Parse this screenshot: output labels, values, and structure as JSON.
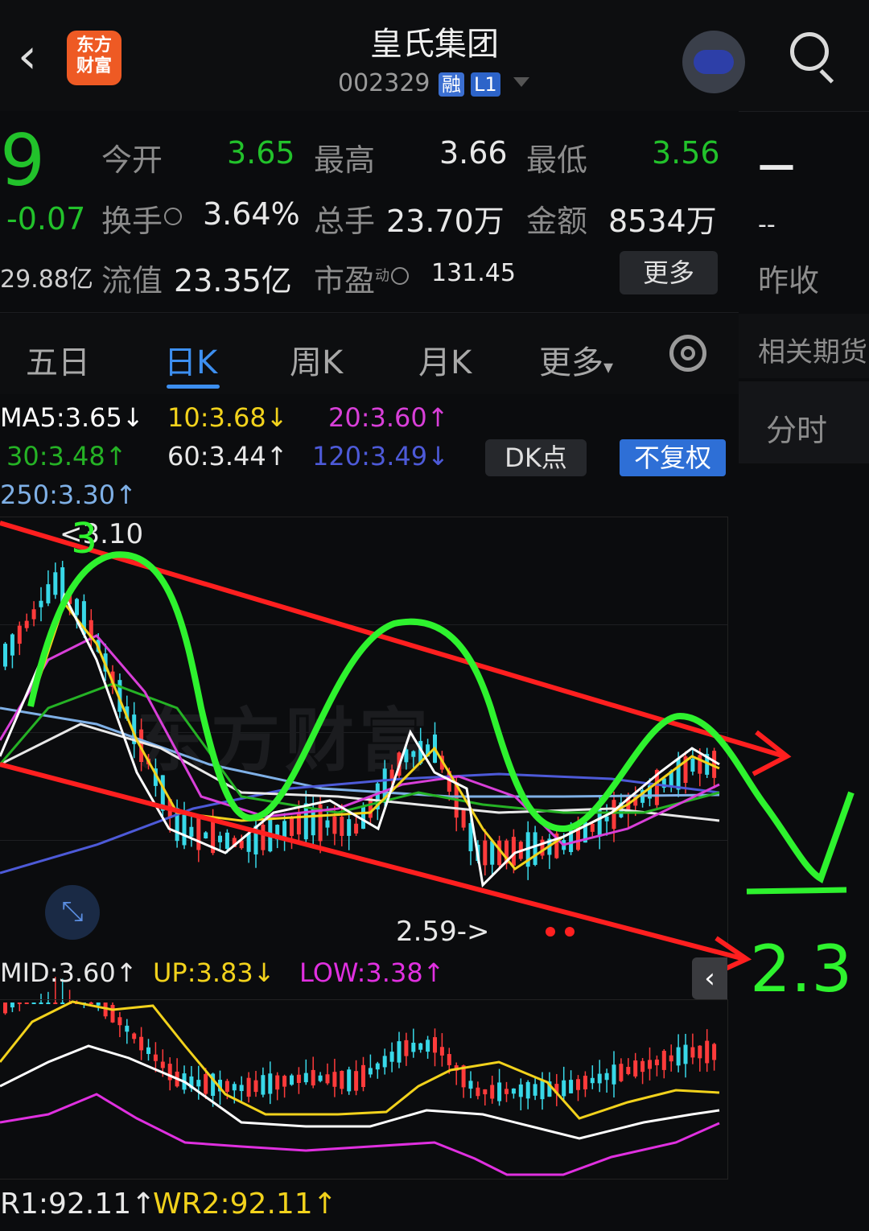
{
  "header": {
    "back_icon": "chevron-left-icon",
    "logo_text_line1": "东方",
    "logo_text_line2": "财富",
    "stock_name": "皇氏集团",
    "stock_code": "002329",
    "tag_margin": "融",
    "tag_level": "L1"
  },
  "quote": {
    "price_partial": "9",
    "change": "-0.07",
    "market_cap_partial": "29.88亿",
    "open_label": "今开",
    "open_value": "3.65",
    "high_label": "最高",
    "high_value": "3.66",
    "low_label": "最低",
    "low_value": "3.56",
    "turnover_label": "换手",
    "turnover_value": "3.64%",
    "volume_label": "总手",
    "volume_value": "23.70万",
    "amount_label": "金额",
    "amount_value": "8534万",
    "float_label": "流值",
    "float_value": "23.35亿",
    "pe_label": "市盈",
    "pe_sup": "动",
    "pe_value": "131.45",
    "more_button": "更多"
  },
  "right_panel": {
    "dash1": "—",
    "dash2": "--",
    "prev_close_label": "昨收",
    "futures_label": "相关期货",
    "intraday_label": "分时"
  },
  "tabs": {
    "items": [
      "五日",
      "日K",
      "周K",
      "月K",
      "更多"
    ],
    "active": "日K",
    "more_caret": "▾"
  },
  "ma_legend": {
    "ma5": "MA5:3.65↓",
    "ma10": "10:3.68↓",
    "ma20": "20:3.60↑",
    "ma30": "30:3.48↑",
    "ma60": "60:3.44↑",
    "ma120": "120:3.49↓",
    "ma250": "250:3.30↑",
    "dk_button": "DK点",
    "adjust_button": "不复权",
    "colors": {
      "ma5": "#ffffff",
      "ma10": "#f2d21c",
      "ma20": "#d83fd8",
      "ma30": "#25b225",
      "ma60": "#e8e8e8",
      "ma120": "#4d5ad8",
      "ma250": "#7fb0e6"
    }
  },
  "main_chart": {
    "high_marker": "<3.10",
    "low_marker": "2.59->",
    "watermark": "东方财富",
    "annotation_3": "3",
    "annotation_target": "2.3"
  },
  "boll_legend": {
    "mid": "MID:3.60↑",
    "up": "UP:3.83↓",
    "low": "LOW:3.38↑"
  },
  "wr_legend": {
    "wr1": "R1:92.11↑",
    "wr2": "WR2:92.11↑"
  }
}
